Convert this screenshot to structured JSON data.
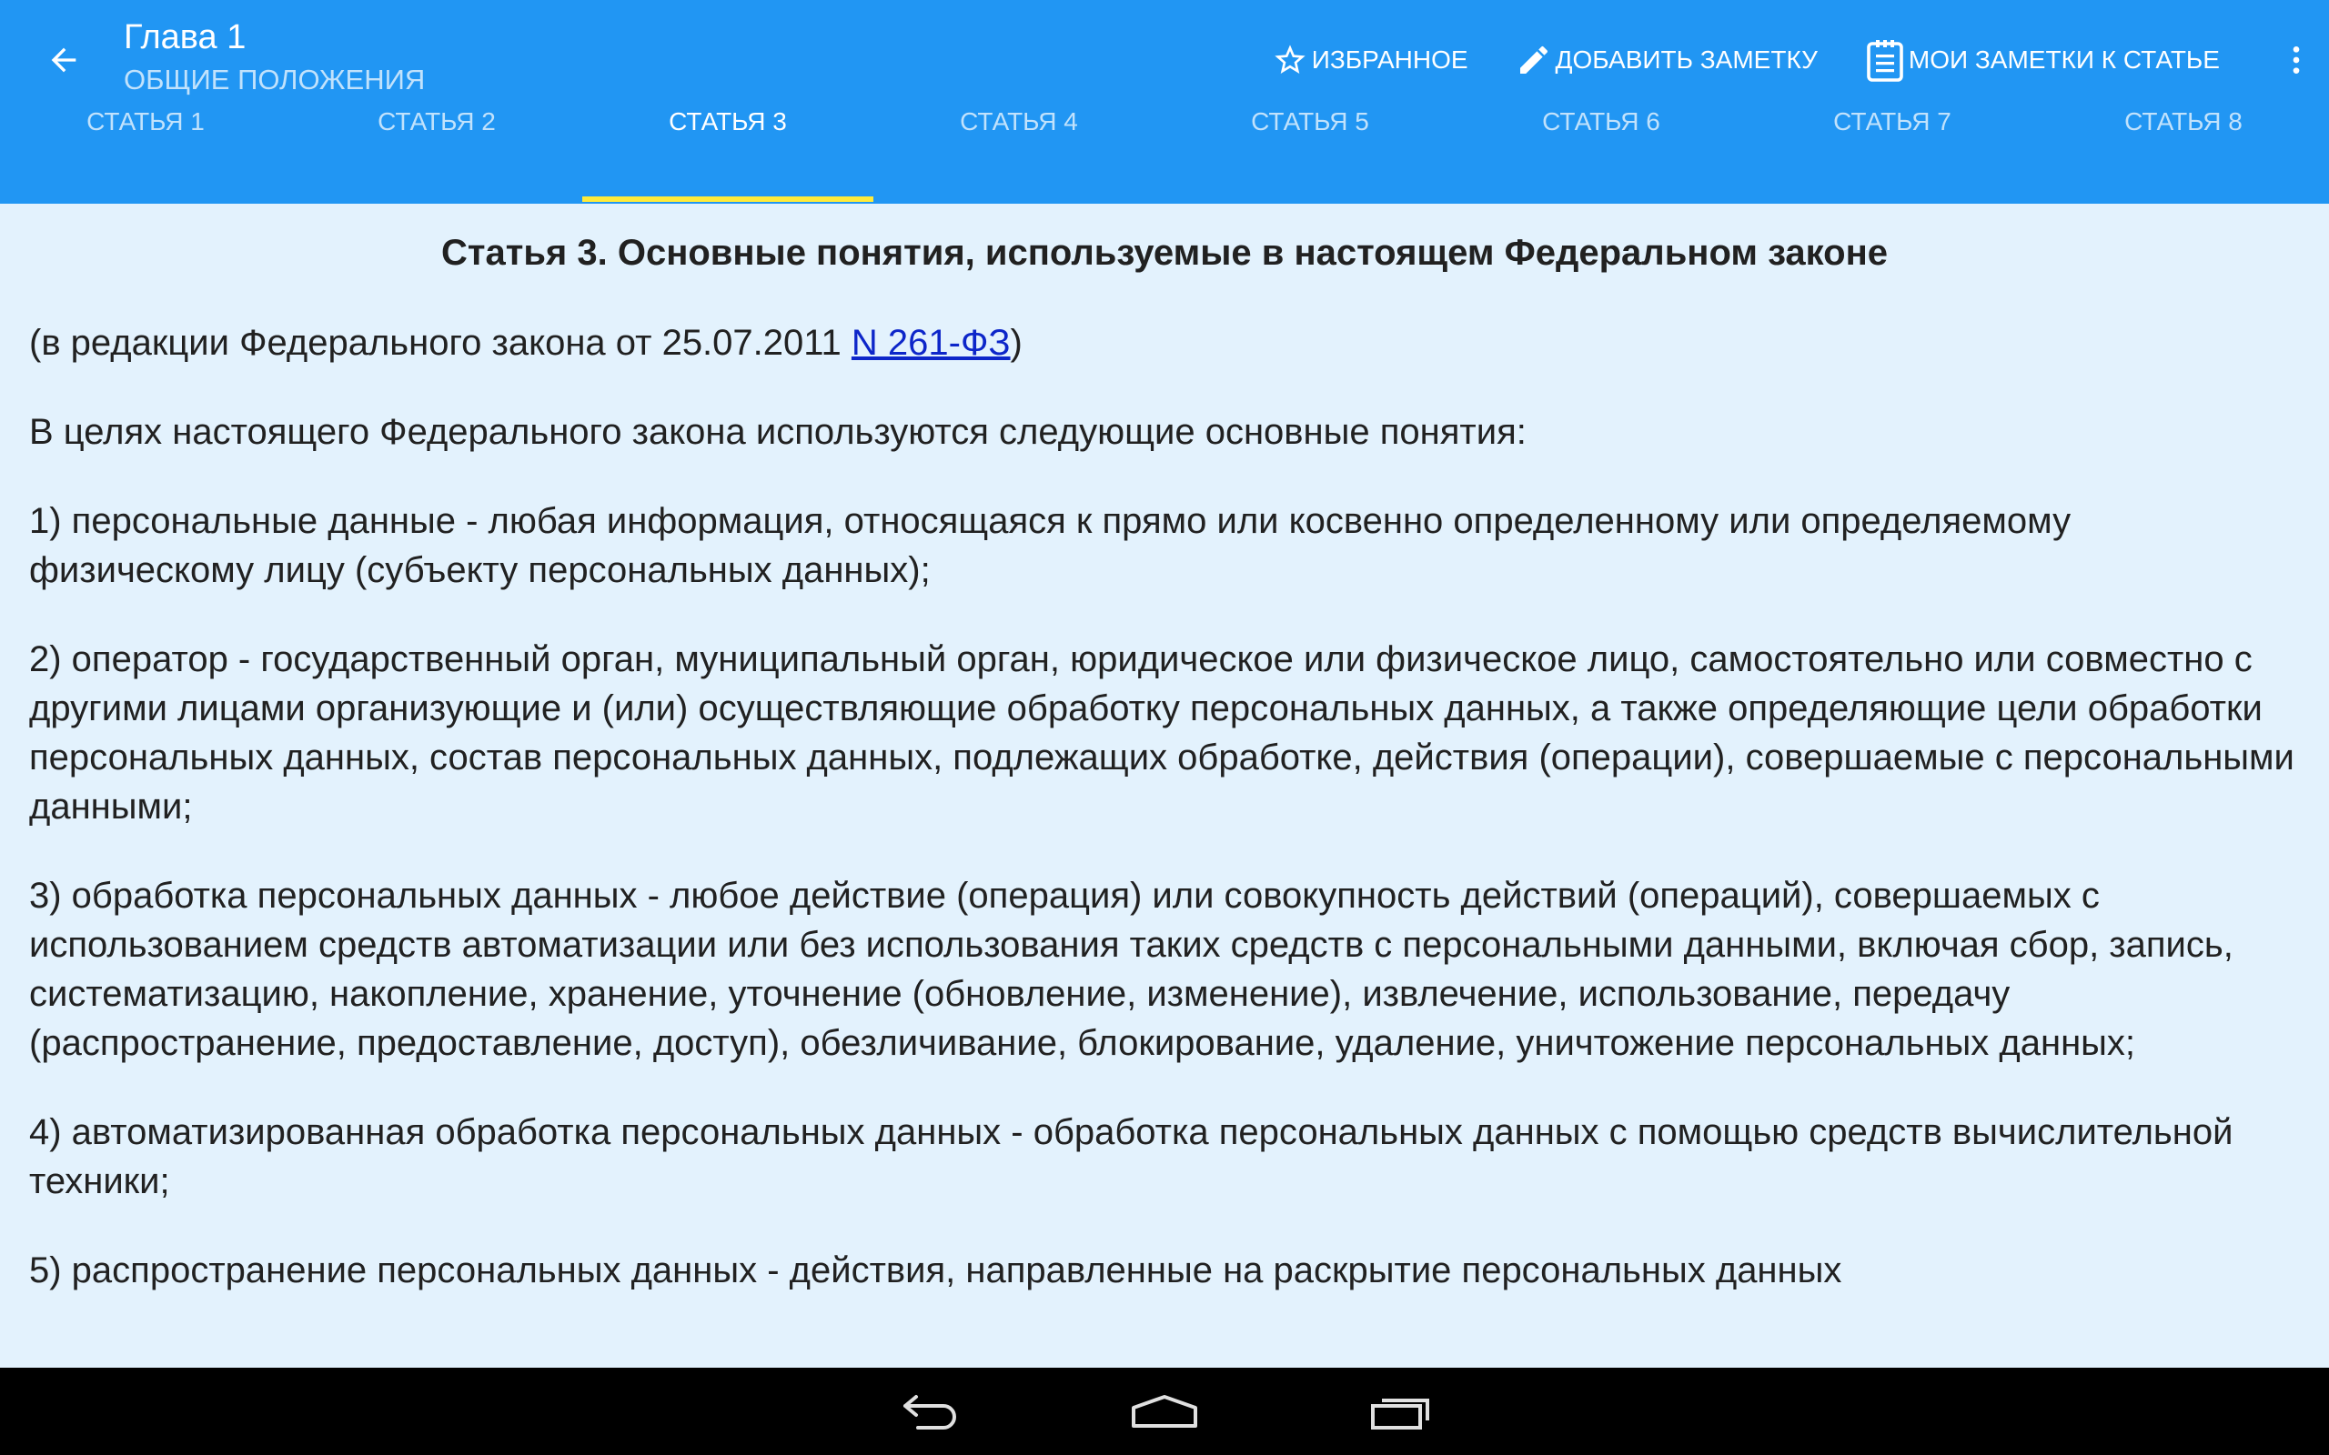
{
  "appbar": {
    "title": "Глава 1",
    "subtitle": "ОБЩИЕ ПОЛОЖЕНИЯ",
    "actions": [
      {
        "label": "ИЗБРАННОЕ",
        "icon": "star-outline-icon"
      },
      {
        "label": "ДОБАВИТЬ ЗАМЕТКУ",
        "icon": "pencil-icon"
      },
      {
        "label": "МОИ ЗАМЕТКИ К СТАТЬЕ",
        "icon": "clipboard-icon"
      }
    ],
    "overflow_icon": "more-vert-icon",
    "back_icon": "arrow-back-icon"
  },
  "tabs": [
    {
      "label": "СТАТЬЯ 1",
      "active": false
    },
    {
      "label": "СТАТЬЯ 2",
      "active": false
    },
    {
      "label": "СТАТЬЯ 3",
      "active": true
    },
    {
      "label": "СТАТЬЯ 4",
      "active": false
    },
    {
      "label": "СТАТЬЯ 5",
      "active": false
    },
    {
      "label": "СТАТЬЯ 6",
      "active": false
    },
    {
      "label": "СТАТЬЯ 7",
      "active": false
    },
    {
      "label": "СТАТЬЯ 8",
      "active": false
    }
  ],
  "article": {
    "title": "Статья 3. Основные понятия, используемые в настоящем Федеральном законе",
    "edition_prefix": "(в редакции Федерального закона от 25.07.2011 ",
    "edition_link": "N 261-ФЗ",
    "edition_suffix": ")",
    "paragraphs": [
      "В целях настоящего Федерального закона используются следующие основные понятия:",
      "1) персональные данные - любая информация, относящаяся к прямо или косвенно определенному или определяемому физическому лицу (субъекту персональных данных);",
      "2) оператор - государственный орган, муниципальный орган, юридическое или физическое лицо, самостоятельно или совместно с другими лицами организующие и (или) осуществляющие обработку персональных данных, а также определяющие цели обработки персональных данных, состав персональных данных, подлежащих обработке, действия (операции), совершаемые с персональными данными;",
      "3) обработка персональных данных - любое действие (операция) или совокупность действий (операций), совершаемых с использованием средств автоматизации или без использования таких средств с персональными данными, включая сбор, запись, систематизацию, накопление, хранение, уточнение (обновление, изменение), извлечение, использование, передачу (распространение, предоставление, доступ), обезличивание, блокирование, удаление, уничтожение персональных данных;",
      "4) автоматизированная обработка персональных данных - обработка персональных данных с помощью средств вычислительной техники;",
      "5) распространение персональных данных - действия, направленные на раскрытие персональных данных"
    ]
  },
  "navbar": {
    "buttons": [
      "back-nav-icon",
      "home-nav-icon",
      "recents-nav-icon"
    ]
  },
  "colors": {
    "primary": "#2196f3",
    "indicator": "#ffeb3b",
    "background": "#e3f2fd",
    "link": "#0d26c9"
  }
}
